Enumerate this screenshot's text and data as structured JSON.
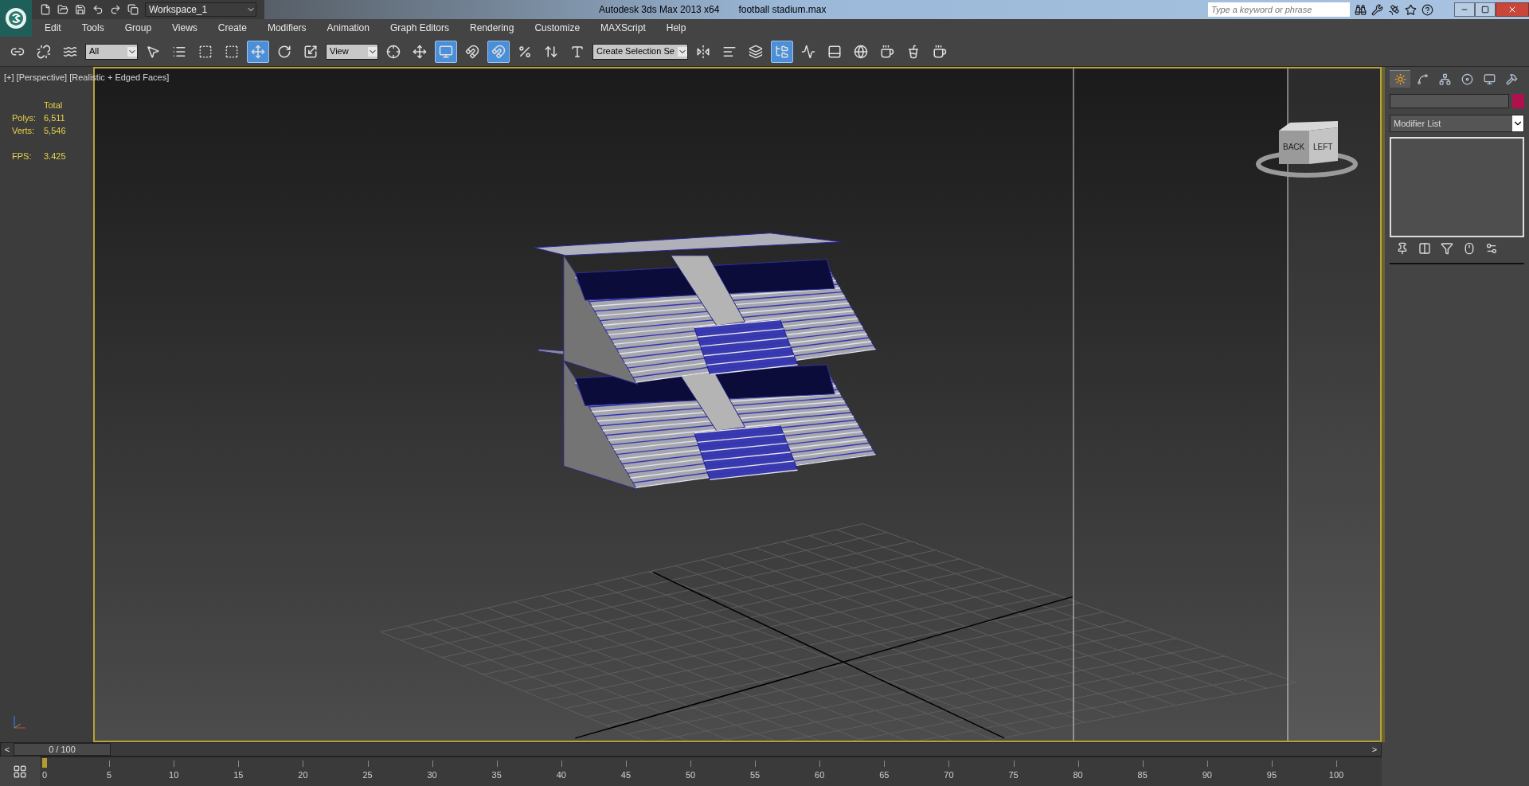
{
  "title_bar": {
    "workspace": "Workspace_1",
    "title": "Autodesk 3ds Max  2013 x64",
    "file": "football stadium.max",
    "search": {
      "placeholder": "Type a keyword or phrase"
    }
  },
  "menu": [
    "Edit",
    "Tools",
    "Group",
    "Views",
    "Create",
    "Modifiers",
    "Animation",
    "Graph Editors",
    "Rendering",
    "Customize",
    "MAXScript",
    "Help"
  ],
  "toolbar": [
    {
      "kind": "button",
      "selected": false
    },
    {
      "kind": "button",
      "selected": false
    },
    {
      "kind": "button",
      "selected": false
    },
    {
      "kind": "dropdown",
      "value": "All"
    },
    {
      "kind": "button",
      "selected": false
    },
    {
      "kind": "button",
      "selected": false
    },
    {
      "kind": "button",
      "selected": false
    },
    {
      "kind": "button",
      "selected": false
    },
    {
      "kind": "button",
      "selected": true
    },
    {
      "kind": "button",
      "selected": false
    },
    {
      "kind": "button",
      "selected": false
    },
    {
      "kind": "dropdown",
      "value": "View"
    },
    {
      "kind": "button",
      "selected": false
    },
    {
      "kind": "button",
      "selected": false
    },
    {
      "kind": "button",
      "selected": true
    },
    {
      "kind": "button",
      "selected": false
    },
    {
      "kind": "button",
      "selected": true
    },
    {
      "kind": "button",
      "selected": false
    },
    {
      "kind": "button",
      "selected": false
    },
    {
      "kind": "button",
      "selected": false
    },
    {
      "kind": "dropdown",
      "value": "Create Selection Se"
    },
    {
      "kind": "button",
      "selected": false
    },
    {
      "kind": "button",
      "selected": false
    },
    {
      "kind": "button",
      "selected": false
    },
    {
      "kind": "button",
      "selected": true
    },
    {
      "kind": "button",
      "selected": false
    },
    {
      "kind": "button",
      "selected": false
    },
    {
      "kind": "button",
      "selected": false
    },
    {
      "kind": "button",
      "selected": false
    },
    {
      "kind": "button",
      "selected": false
    },
    {
      "kind": "button",
      "selected": false
    }
  ],
  "viewport": {
    "label": "[+] [Perspective] [Realistic + Edged Faces]",
    "stats": {
      "heading": "Total",
      "rows": [
        {
          "label": "Polys:",
          "value": "6,511"
        },
        {
          "label": "Verts:",
          "value": "5,546"
        },
        {
          "label": "FPS:",
          "value": "3.425"
        }
      ]
    },
    "viewcube": [
      "BACK",
      "LEFT"
    ]
  },
  "command_panel": {
    "tabs": [
      {
        "selected": true
      },
      {
        "selected": false
      },
      {
        "selected": false
      },
      {
        "selected": false
      },
      {
        "selected": false
      },
      {
        "selected": false
      }
    ],
    "modifier_list": "Modifier List"
  },
  "timeline": {
    "frame": "0 / 100",
    "level": 0,
    "prev": "<",
    "next": ">",
    "labels": [
      "0",
      "5",
      "10",
      "15",
      "20",
      "25",
      "30",
      "35",
      "40",
      "45",
      "50",
      "55",
      "60",
      "65",
      "70",
      "75",
      "80",
      "85",
      "90",
      "95",
      "100"
    ]
  }
}
